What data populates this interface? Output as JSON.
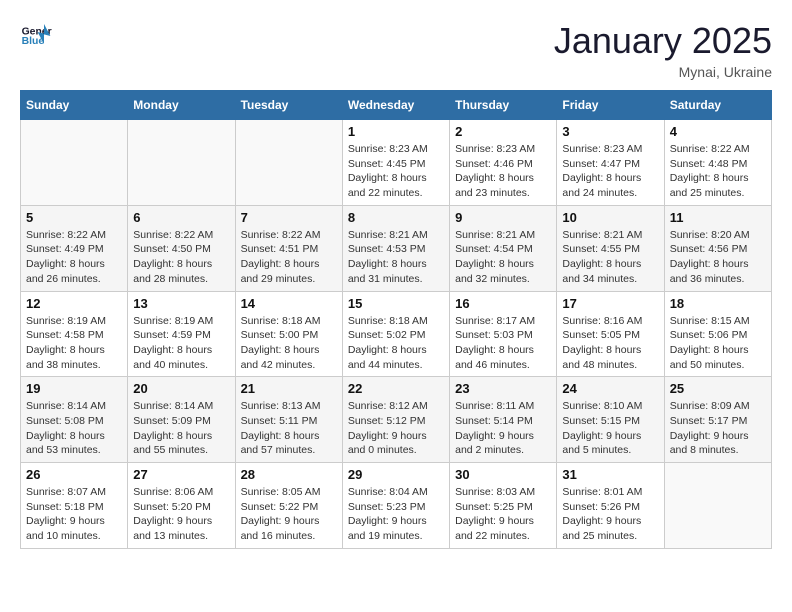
{
  "header": {
    "logo_line1": "General",
    "logo_line2": "Blue",
    "month": "January 2025",
    "location": "Mynai, Ukraine"
  },
  "weekdays": [
    "Sunday",
    "Monday",
    "Tuesday",
    "Wednesday",
    "Thursday",
    "Friday",
    "Saturday"
  ],
  "weeks": [
    [
      {
        "day": "",
        "content": ""
      },
      {
        "day": "",
        "content": ""
      },
      {
        "day": "",
        "content": ""
      },
      {
        "day": "1",
        "content": "Sunrise: 8:23 AM\nSunset: 4:45 PM\nDaylight: 8 hours and 22 minutes."
      },
      {
        "day": "2",
        "content": "Sunrise: 8:23 AM\nSunset: 4:46 PM\nDaylight: 8 hours and 23 minutes."
      },
      {
        "day": "3",
        "content": "Sunrise: 8:23 AM\nSunset: 4:47 PM\nDaylight: 8 hours and 24 minutes."
      },
      {
        "day": "4",
        "content": "Sunrise: 8:22 AM\nSunset: 4:48 PM\nDaylight: 8 hours and 25 minutes."
      }
    ],
    [
      {
        "day": "5",
        "content": "Sunrise: 8:22 AM\nSunset: 4:49 PM\nDaylight: 8 hours and 26 minutes."
      },
      {
        "day": "6",
        "content": "Sunrise: 8:22 AM\nSunset: 4:50 PM\nDaylight: 8 hours and 28 minutes."
      },
      {
        "day": "7",
        "content": "Sunrise: 8:22 AM\nSunset: 4:51 PM\nDaylight: 8 hours and 29 minutes."
      },
      {
        "day": "8",
        "content": "Sunrise: 8:21 AM\nSunset: 4:53 PM\nDaylight: 8 hours and 31 minutes."
      },
      {
        "day": "9",
        "content": "Sunrise: 8:21 AM\nSunset: 4:54 PM\nDaylight: 8 hours and 32 minutes."
      },
      {
        "day": "10",
        "content": "Sunrise: 8:21 AM\nSunset: 4:55 PM\nDaylight: 8 hours and 34 minutes."
      },
      {
        "day": "11",
        "content": "Sunrise: 8:20 AM\nSunset: 4:56 PM\nDaylight: 8 hours and 36 minutes."
      }
    ],
    [
      {
        "day": "12",
        "content": "Sunrise: 8:19 AM\nSunset: 4:58 PM\nDaylight: 8 hours and 38 minutes."
      },
      {
        "day": "13",
        "content": "Sunrise: 8:19 AM\nSunset: 4:59 PM\nDaylight: 8 hours and 40 minutes."
      },
      {
        "day": "14",
        "content": "Sunrise: 8:18 AM\nSunset: 5:00 PM\nDaylight: 8 hours and 42 minutes."
      },
      {
        "day": "15",
        "content": "Sunrise: 8:18 AM\nSunset: 5:02 PM\nDaylight: 8 hours and 44 minutes."
      },
      {
        "day": "16",
        "content": "Sunrise: 8:17 AM\nSunset: 5:03 PM\nDaylight: 8 hours and 46 minutes."
      },
      {
        "day": "17",
        "content": "Sunrise: 8:16 AM\nSunset: 5:05 PM\nDaylight: 8 hours and 48 minutes."
      },
      {
        "day": "18",
        "content": "Sunrise: 8:15 AM\nSunset: 5:06 PM\nDaylight: 8 hours and 50 minutes."
      }
    ],
    [
      {
        "day": "19",
        "content": "Sunrise: 8:14 AM\nSunset: 5:08 PM\nDaylight: 8 hours and 53 minutes."
      },
      {
        "day": "20",
        "content": "Sunrise: 8:14 AM\nSunset: 5:09 PM\nDaylight: 8 hours and 55 minutes."
      },
      {
        "day": "21",
        "content": "Sunrise: 8:13 AM\nSunset: 5:11 PM\nDaylight: 8 hours and 57 minutes."
      },
      {
        "day": "22",
        "content": "Sunrise: 8:12 AM\nSunset: 5:12 PM\nDaylight: 9 hours and 0 minutes."
      },
      {
        "day": "23",
        "content": "Sunrise: 8:11 AM\nSunset: 5:14 PM\nDaylight: 9 hours and 2 minutes."
      },
      {
        "day": "24",
        "content": "Sunrise: 8:10 AM\nSunset: 5:15 PM\nDaylight: 9 hours and 5 minutes."
      },
      {
        "day": "25",
        "content": "Sunrise: 8:09 AM\nSunset: 5:17 PM\nDaylight: 9 hours and 8 minutes."
      }
    ],
    [
      {
        "day": "26",
        "content": "Sunrise: 8:07 AM\nSunset: 5:18 PM\nDaylight: 9 hours and 10 minutes."
      },
      {
        "day": "27",
        "content": "Sunrise: 8:06 AM\nSunset: 5:20 PM\nDaylight: 9 hours and 13 minutes."
      },
      {
        "day": "28",
        "content": "Sunrise: 8:05 AM\nSunset: 5:22 PM\nDaylight: 9 hours and 16 minutes."
      },
      {
        "day": "29",
        "content": "Sunrise: 8:04 AM\nSunset: 5:23 PM\nDaylight: 9 hours and 19 minutes."
      },
      {
        "day": "30",
        "content": "Sunrise: 8:03 AM\nSunset: 5:25 PM\nDaylight: 9 hours and 22 minutes."
      },
      {
        "day": "31",
        "content": "Sunrise: 8:01 AM\nSunset: 5:26 PM\nDaylight: 9 hours and 25 minutes."
      },
      {
        "day": "",
        "content": ""
      }
    ]
  ]
}
